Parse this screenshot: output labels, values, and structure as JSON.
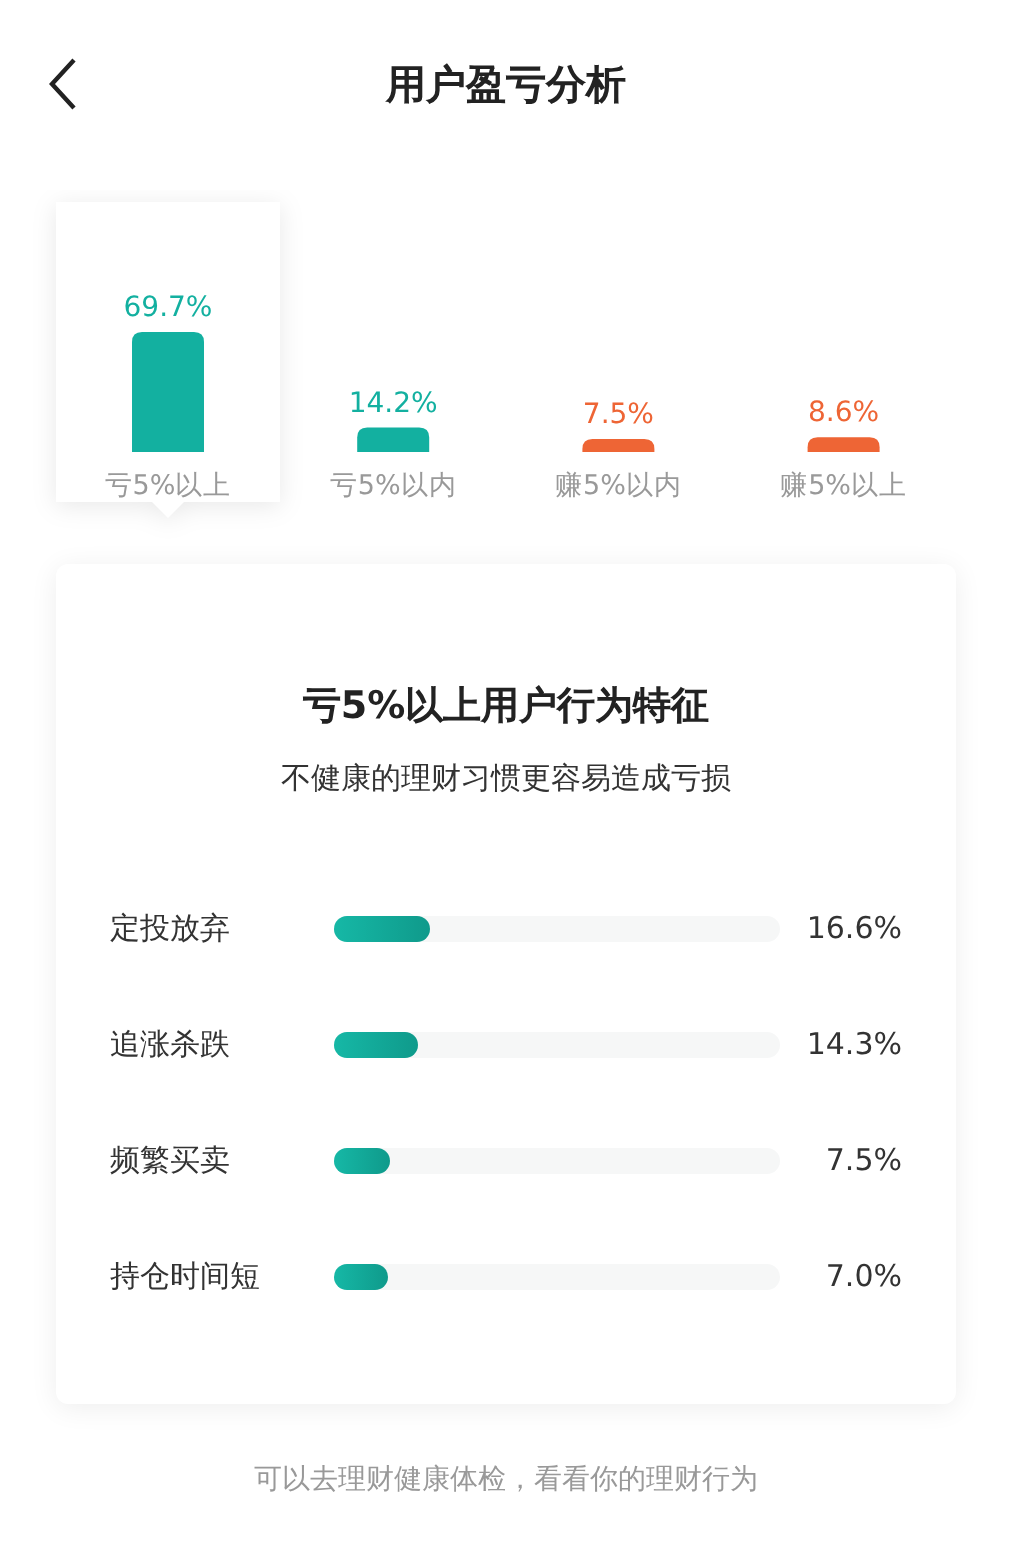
{
  "header": {
    "title": "用户盈亏分析"
  },
  "distribution": {
    "segments": [
      {
        "selected": true,
        "color": "#13b0a0"
      },
      {
        "selected": false,
        "color": "#13b0a0"
      },
      {
        "selected": false,
        "color": "#ee6535"
      },
      {
        "selected": false,
        "color": "#ee6535"
      }
    ],
    "chart_data": {
      "type": "bar",
      "categories": [
        "亏5%以上",
        "亏5%以内",
        "赚5%以内",
        "赚5%以上"
      ],
      "values": [
        69.7,
        14.2,
        7.5,
        8.6
      ],
      "value_labels": [
        "69.7%",
        "14.2%",
        "7.5%",
        "8.6%"
      ]
    }
  },
  "behavior_card": {
    "title": "亏5%以上用户行为特征",
    "subtitle": "不健康的理财习惯更容易造成亏损",
    "traits": [
      {
        "name": "定投放弃",
        "level": 0.215,
        "reading": "16.6%"
      },
      {
        "name": "追涨杀跌",
        "level": 0.19,
        "reading": "14.3%"
      },
      {
        "name": "频繁买卖",
        "level": 0.125,
        "reading": "7.5%"
      },
      {
        "name": "持仓时间短",
        "level": 0.12,
        "reading": "7.0%"
      }
    ]
  },
  "footer": {
    "text": "可以去理财健康体检，看看你的理财行为"
  }
}
